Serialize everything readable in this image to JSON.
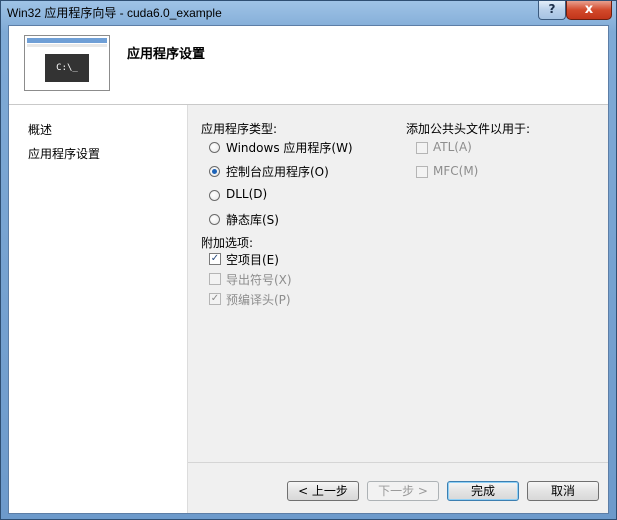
{
  "window": {
    "title": "Win32 应用程序向导 - cuda6.0_example",
    "help": "?",
    "close": "x"
  },
  "header": {
    "title": "应用程序设置",
    "image_text": "C:\\_"
  },
  "nav": {
    "items": [
      "概述",
      "应用程序设置"
    ]
  },
  "app_type": {
    "label": "应用程序类型:",
    "options": [
      "Windows 应用程序(W)",
      "控制台应用程序(O)",
      "DLL(D)",
      "静态库(S)"
    ],
    "selected": "控制台应用程序(O)"
  },
  "extra_options": {
    "label": "附加选项:",
    "items": [
      {
        "label": "空项目(E)",
        "checked": true,
        "enabled": true
      },
      {
        "label": "导出符号(X)",
        "checked": false,
        "enabled": false
      },
      {
        "label": "预编译头(P)",
        "checked": true,
        "enabled": false
      }
    ]
  },
  "headers": {
    "label": "添加公共头文件以用于:",
    "items": [
      {
        "label": "ATL(A)",
        "checked": false,
        "enabled": false
      },
      {
        "label": "MFC(M)",
        "checked": false,
        "enabled": false
      }
    ]
  },
  "buttons": {
    "prev": "< 上一步",
    "next": "下一步 >",
    "finish": "完成",
    "cancel": "取消"
  }
}
